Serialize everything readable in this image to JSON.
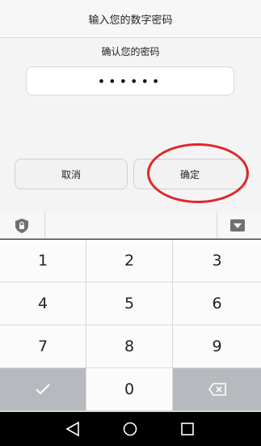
{
  "dialog": {
    "title": "输入您的数字密码",
    "subtitle": "确认您的密码",
    "password_masked": "••••••",
    "cancel_label": "取消",
    "confirm_label": "确定",
    "highlight_color": "#e0262a"
  },
  "keyboard": {
    "toolbar": {
      "left_icon": "lock-shield-icon",
      "right_icon": "keyboard-hide-icon"
    },
    "keys": [
      "1",
      "2",
      "3",
      "4",
      "5",
      "6",
      "7",
      "8",
      "9",
      "✓",
      "0",
      "⌫"
    ]
  },
  "navbar": {
    "icons": [
      "back-triangle-icon",
      "home-circle-icon",
      "recents-square-icon"
    ]
  }
}
